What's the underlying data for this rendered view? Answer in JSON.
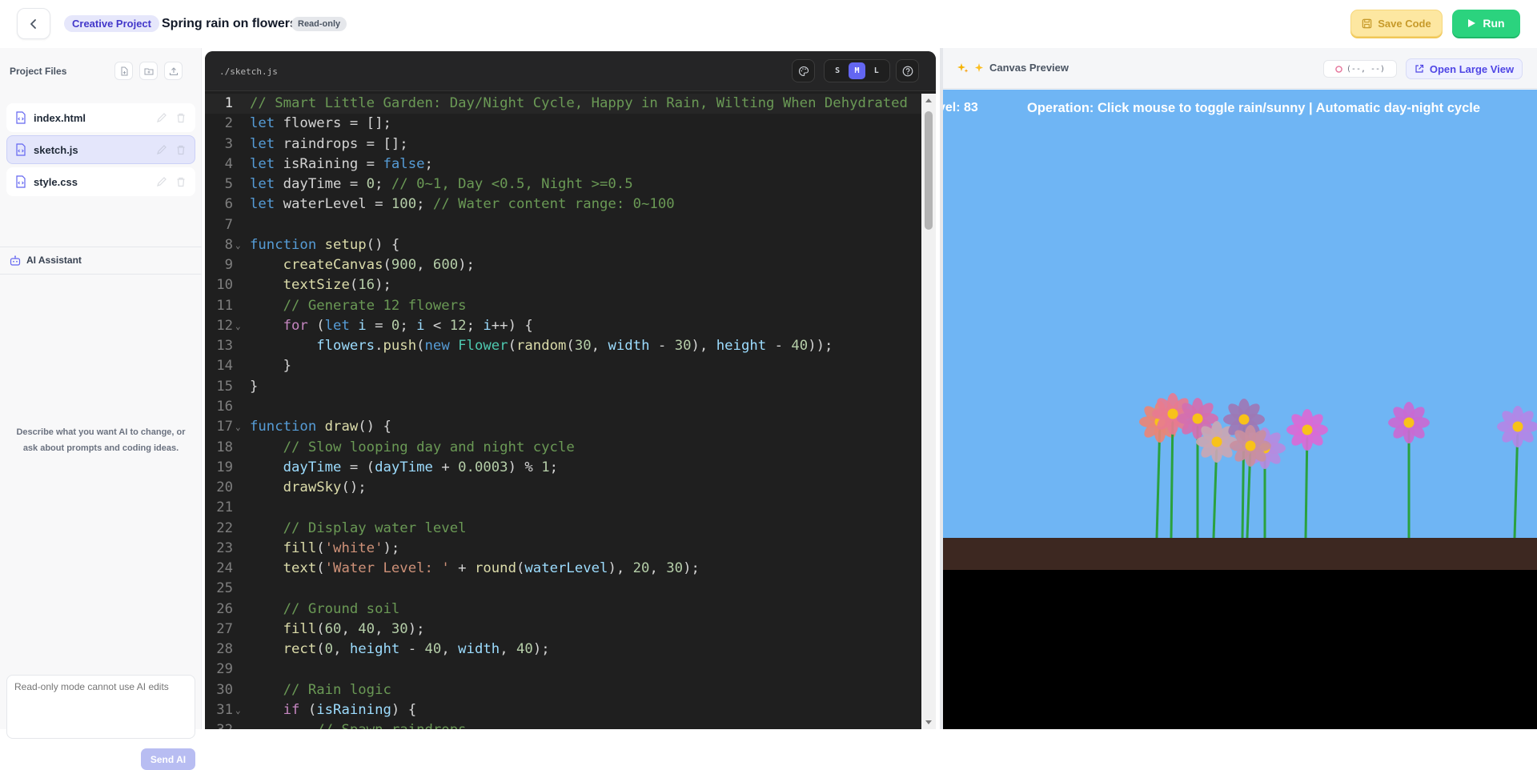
{
  "header": {
    "project_tag": "Creative Project",
    "title": "Spring rain on flowers",
    "mode_badge": "Read-only",
    "save_label": "Save Code",
    "run_label": "Run"
  },
  "sidebar": {
    "files_title": "Project Files",
    "files": [
      {
        "name": "index.html",
        "active": false
      },
      {
        "name": "sketch.js",
        "active": true
      },
      {
        "name": "style.css",
        "active": false
      }
    ],
    "ai_title": "AI Assistant",
    "ai_hint": "Describe what you want AI to change, or ask about prompts and coding ideas.",
    "ai_input_placeholder": "Read-only mode cannot use AI edits",
    "send_label": "Send AI"
  },
  "editor": {
    "path": "./sketch.js",
    "size_options": [
      "S",
      "M",
      "L"
    ],
    "size_selected": "M",
    "current_line": 1,
    "lines": [
      [
        [
          "c",
          "// Smart Little Garden: Day/Night Cycle, Happy in Rain, Wilting When Dehydrated"
        ]
      ],
      [
        [
          "k",
          "let "
        ],
        [
          "d",
          "flowers = [];"
        ]
      ],
      [
        [
          "k",
          "let "
        ],
        [
          "d",
          "raindrops = [];"
        ]
      ],
      [
        [
          "k",
          "let "
        ],
        [
          "d",
          "isRaining = "
        ],
        [
          "k",
          "false"
        ],
        [
          "d",
          ";"
        ]
      ],
      [
        [
          "k",
          "let "
        ],
        [
          "d",
          "dayTime = "
        ],
        [
          "n",
          "0"
        ],
        [
          "d",
          "; "
        ],
        [
          "c",
          "// 0~1, Day <0.5, Night >=0.5"
        ]
      ],
      [
        [
          "k",
          "let "
        ],
        [
          "d",
          "waterLevel = "
        ],
        [
          "n",
          "100"
        ],
        [
          "d",
          "; "
        ],
        [
          "c",
          "// Water content range: 0~100"
        ]
      ],
      [],
      [
        [
          "k",
          "function "
        ],
        [
          "f",
          "setup"
        ],
        [
          "d",
          "() {"
        ]
      ],
      [
        [
          "d",
          "    "
        ],
        [
          "f",
          "createCanvas"
        ],
        [
          "d",
          "("
        ],
        [
          "n",
          "900"
        ],
        [
          "d",
          ", "
        ],
        [
          "n",
          "600"
        ],
        [
          "d",
          ");"
        ]
      ],
      [
        [
          "d",
          "    "
        ],
        [
          "f",
          "textSize"
        ],
        [
          "d",
          "("
        ],
        [
          "n",
          "16"
        ],
        [
          "d",
          ");"
        ]
      ],
      [
        [
          "d",
          "    "
        ],
        [
          "c",
          "// Generate 12 flowers"
        ]
      ],
      [
        [
          "d",
          "    "
        ],
        [
          "x",
          "for "
        ],
        [
          "d",
          "("
        ],
        [
          "k",
          "let "
        ],
        [
          "v",
          "i"
        ],
        [
          "d",
          " = "
        ],
        [
          "n",
          "0"
        ],
        [
          "d",
          "; "
        ],
        [
          "v",
          "i"
        ],
        [
          "d",
          " < "
        ],
        [
          "n",
          "12"
        ],
        [
          "d",
          "; "
        ],
        [
          "v",
          "i"
        ],
        [
          "d",
          "++) {"
        ]
      ],
      [
        [
          "d",
          "        "
        ],
        [
          "v",
          "flowers"
        ],
        [
          "d",
          "."
        ],
        [
          "f",
          "push"
        ],
        [
          "d",
          "("
        ],
        [
          "k",
          "new "
        ],
        [
          "t",
          "Flower"
        ],
        [
          "d",
          "("
        ],
        [
          "f",
          "random"
        ],
        [
          "d",
          "("
        ],
        [
          "n",
          "30"
        ],
        [
          "d",
          ", "
        ],
        [
          "v",
          "width"
        ],
        [
          "d",
          " - "
        ],
        [
          "n",
          "30"
        ],
        [
          "d",
          "), "
        ],
        [
          "v",
          "height"
        ],
        [
          "d",
          " - "
        ],
        [
          "n",
          "40"
        ],
        [
          "d",
          "));"
        ]
      ],
      [
        [
          "d",
          "    }"
        ]
      ],
      [
        [
          "d",
          "}"
        ]
      ],
      [],
      [
        [
          "k",
          "function "
        ],
        [
          "f",
          "draw"
        ],
        [
          "d",
          "() {"
        ]
      ],
      [
        [
          "d",
          "    "
        ],
        [
          "c",
          "// Slow looping day and night cycle"
        ]
      ],
      [
        [
          "d",
          "    "
        ],
        [
          "v",
          "dayTime"
        ],
        [
          "d",
          " = ("
        ],
        [
          "v",
          "dayTime"
        ],
        [
          "d",
          " + "
        ],
        [
          "n",
          "0.0003"
        ],
        [
          "d",
          ") % "
        ],
        [
          "n",
          "1"
        ],
        [
          "d",
          ";"
        ]
      ],
      [
        [
          "d",
          "    "
        ],
        [
          "f",
          "drawSky"
        ],
        [
          "d",
          "();"
        ]
      ],
      [],
      [
        [
          "d",
          "    "
        ],
        [
          "c",
          "// Display water level"
        ]
      ],
      [
        [
          "d",
          "    "
        ],
        [
          "f",
          "fill"
        ],
        [
          "d",
          "("
        ],
        [
          "s",
          "'white'"
        ],
        [
          "d",
          ");"
        ]
      ],
      [
        [
          "d",
          "    "
        ],
        [
          "f",
          "text"
        ],
        [
          "d",
          "("
        ],
        [
          "s",
          "'Water Level: '"
        ],
        [
          "d",
          " + "
        ],
        [
          "f",
          "round"
        ],
        [
          "d",
          "("
        ],
        [
          "v",
          "waterLevel"
        ],
        [
          "d",
          "), "
        ],
        [
          "n",
          "20"
        ],
        [
          "d",
          ", "
        ],
        [
          "n",
          "30"
        ],
        [
          "d",
          ");"
        ]
      ],
      [],
      [
        [
          "d",
          "    "
        ],
        [
          "c",
          "// Ground soil"
        ]
      ],
      [
        [
          "d",
          "    "
        ],
        [
          "f",
          "fill"
        ],
        [
          "d",
          "("
        ],
        [
          "n",
          "60"
        ],
        [
          "d",
          ", "
        ],
        [
          "n",
          "40"
        ],
        [
          "d",
          ", "
        ],
        [
          "n",
          "30"
        ],
        [
          "d",
          ");"
        ]
      ],
      [
        [
          "d",
          "    "
        ],
        [
          "f",
          "rect"
        ],
        [
          "d",
          "("
        ],
        [
          "n",
          "0"
        ],
        [
          "d",
          ", "
        ],
        [
          "v",
          "height"
        ],
        [
          "d",
          " - "
        ],
        [
          "n",
          "40"
        ],
        [
          "d",
          ", "
        ],
        [
          "v",
          "width"
        ],
        [
          "d",
          ", "
        ],
        [
          "n",
          "40"
        ],
        [
          "d",
          ");"
        ]
      ],
      [],
      [
        [
          "d",
          "    "
        ],
        [
          "c",
          "// Rain logic"
        ]
      ],
      [
        [
          "d",
          "    "
        ],
        [
          "x",
          "if "
        ],
        [
          "d",
          "("
        ],
        [
          "v",
          "isRaining"
        ],
        [
          "d",
          ") {"
        ]
      ],
      [
        [
          "d",
          "        "
        ],
        [
          "c",
          "// Spawn raindrops"
        ]
      ]
    ],
    "fold_lines": [
      8,
      12,
      17,
      31
    ]
  },
  "preview": {
    "title": "Canvas Preview",
    "coord_readout": "(--, --)",
    "open_large_label": "Open Large View",
    "canvas": {
      "water_level_text": "vel: 83",
      "operation_text": "Operation: Click mouse to toggle rain/sunny | Automatic day-night cycle",
      "sky_color": "#6fb5f4",
      "soil_color": "#3d2821",
      "stem_color": "#2aa13e",
      "center_color": "#f8c21a",
      "petal_colors": [
        "#e98676",
        "#e77b90",
        "#d46fb0",
        "#c98fa0",
        "#9d78b5",
        "#c9a7b3",
        "#b58be0",
        "#d96ad6",
        "#c96ad3",
        "#b287e6"
      ]
    }
  }
}
